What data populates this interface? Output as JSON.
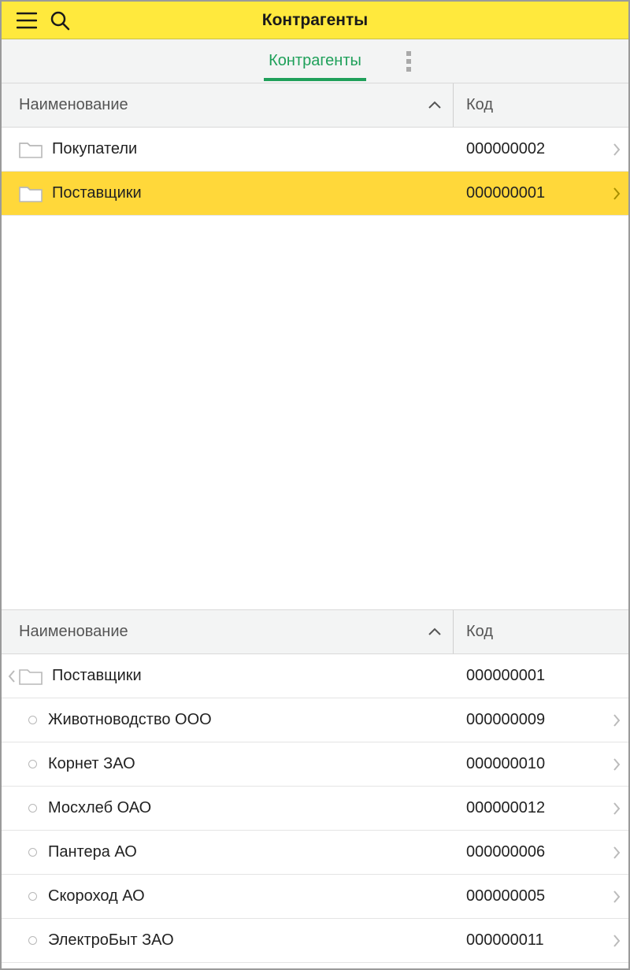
{
  "header": {
    "title": "Контрагенты"
  },
  "tabs": {
    "active_label": "Контрагенты"
  },
  "columns": {
    "name": "Наименование",
    "code": "Код"
  },
  "top_folders": [
    {
      "label": "Покупатели",
      "code": "000000002",
      "selected": false
    },
    {
      "label": "Поставщики",
      "code": "000000001",
      "selected": true
    }
  ],
  "open_folder": {
    "label": "Поставщики",
    "code": "000000001"
  },
  "items": [
    {
      "label": "Животноводство ООО",
      "code": "000000009"
    },
    {
      "label": "Корнет ЗАО",
      "code": "000000010"
    },
    {
      "label": "Мосхлеб ОАО",
      "code": "000000012"
    },
    {
      "label": "Пантера АО",
      "code": "000000006"
    },
    {
      "label": "Скороход АО",
      "code": "000000005"
    },
    {
      "label": "ЭлектроБыт ЗАО",
      "code": "000000011"
    }
  ]
}
